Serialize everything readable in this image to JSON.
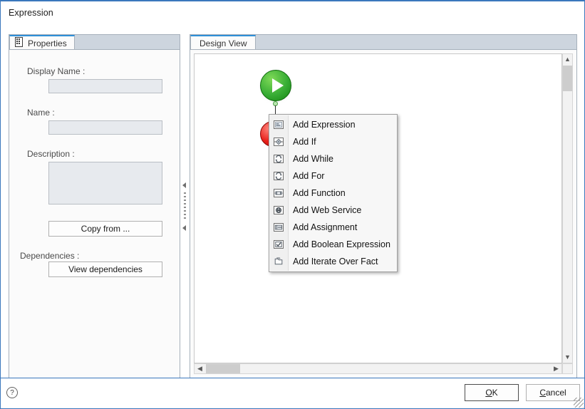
{
  "window": {
    "title": "Expression"
  },
  "left_panel": {
    "tab": {
      "label": "Properties",
      "icon": "properties-document-icon"
    },
    "fields": [
      {
        "label": "Display Name :",
        "value": "",
        "placeholder": ""
      },
      {
        "label": "Name :",
        "value": "",
        "placeholder": ""
      },
      {
        "label": "Description :",
        "value": "",
        "placeholder": ""
      }
    ],
    "copy_from_label": "Copy from ...",
    "dependencies_label": "Dependencies :",
    "view_dependencies_label": "View dependencies"
  },
  "splitter": {
    "collapse_left_icon": "triangle-left-icon",
    "grip_icon": "grip-dots-icon"
  },
  "right_panel": {
    "tab": {
      "label": "Design View"
    },
    "canvas": {
      "nodes": [
        {
          "name": "start-node",
          "type": "start",
          "icon": "play-triangle-icon"
        },
        {
          "name": "stop-node",
          "type": "stop",
          "icon": "stop-square-icon"
        }
      ]
    },
    "vscroll": {
      "up_icon": "chevron-up-icon",
      "down_icon": "chevron-down-icon"
    },
    "hscroll": {
      "left_icon": "chevron-left-icon",
      "right_icon": "chevron-right-icon"
    }
  },
  "context_menu": {
    "items": [
      {
        "label": "Add Expression",
        "icon": "expression-icon"
      },
      {
        "label": "Add If",
        "icon": "decision-diamond-icon"
      },
      {
        "label": "Add While",
        "icon": "loop-while-icon"
      },
      {
        "label": "Add For",
        "icon": "loop-for-icon"
      },
      {
        "label": "Add Function",
        "icon": "function-icon"
      },
      {
        "label": "Add Web Service",
        "icon": "web-service-globe-icon"
      },
      {
        "label": "Add Assignment",
        "icon": "assignment-icon"
      },
      {
        "label": "Add Boolean Expression",
        "icon": "checkbox-icon"
      },
      {
        "label": "Add Iterate Over Fact",
        "icon": "iterate-folder-icon"
      }
    ]
  },
  "footer": {
    "help_icon": "help-question-icon",
    "ok": {
      "label": "OK",
      "mnemonic": "O"
    },
    "cancel": {
      "label": "Cancel",
      "mnemonic": "C"
    }
  },
  "colors": {
    "window_border": "#3a77bd",
    "tab_strip": "#cdd5de",
    "panel_bg": "#fbfbfb",
    "field_bg": "#e7eaee",
    "start_node": "#38ad35",
    "stop_node": "#e8201b"
  }
}
